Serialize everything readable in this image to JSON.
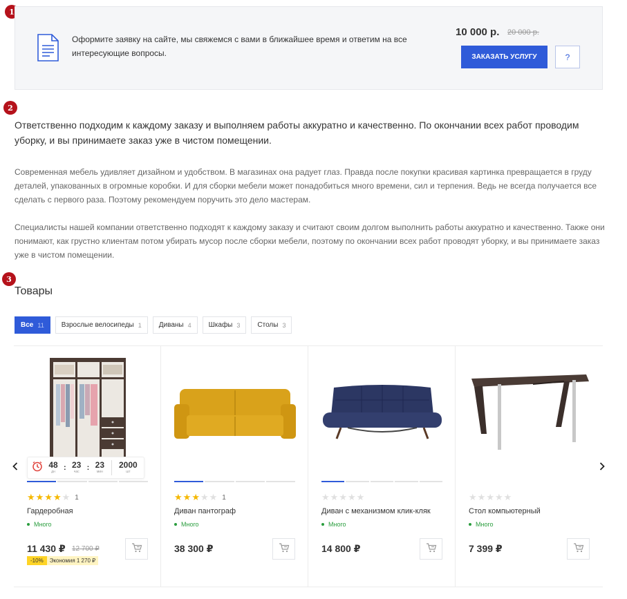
{
  "markers": [
    "1",
    "2",
    "3"
  ],
  "banner": {
    "text": "Оформите заявку на сайте, мы свяжемся с вами в ближайшее время и ответим на все интересующие вопросы.",
    "price": "10 000 р.",
    "old_price": "20 000 р.",
    "order_label": "ЗАКАЗАТЬ УСЛУГУ",
    "help_label": "?"
  },
  "content": {
    "lead": "Ответственно подходим к каждому заказу и выполняем работы аккуратно и качественно. По окончании всех работ проводим уборку, и вы принимаете заказ уже в чистом помещении.",
    "paragraph1": "Современная мебель удивляет дизайном и удобством. В магазинах она радует глаз. Правда после покупки красивая картинка превращается в груду деталей, упакованных в огромные коробки. И для сборки мебели может понадобиться много времени, сил и терпения. Ведь не всегда получается все сделать с первого раза. Поэтому рекомендуем поручить это дело мастерам.",
    "paragraph2": "Специалисты нашей компании ответственно подходят к каждому заказу и считают своим долгом выполнить работы аккуратно и качественно. Также они понимают, как грустно клиентам потом убирать мусор после сборки мебели, поэтому по окончании всех работ проводят уборку, и вы принимаете заказ уже в чистом помещении."
  },
  "products_section": {
    "title": "Товары",
    "filters": [
      {
        "label": "Все",
        "count": "11",
        "active": true
      },
      {
        "label": "Взрослые велосипеды",
        "count": "1",
        "active": false
      },
      {
        "label": "Диваны",
        "count": "4",
        "active": false
      },
      {
        "label": "Шкафы",
        "count": "3",
        "active": false
      },
      {
        "label": "Столы",
        "count": "3",
        "active": false
      }
    ],
    "products": [
      {
        "name": "Гардеробная",
        "stock": "Много",
        "price": "11 430 ₽",
        "old_price": "12 700 ₽",
        "rating": 4,
        "reviews": "1",
        "discount": "-10%",
        "economy": "Экономия 1 270 ₽",
        "image": "wardrobe",
        "dots": 4,
        "active_dot": 0,
        "timer": {
          "days": "48",
          "days_label": "дн",
          "hours": "23",
          "hours_label": "час",
          "minutes": "23",
          "minutes_label": "мин",
          "qty": "2000",
          "qty_label": "шт"
        }
      },
      {
        "name": "Диван пантограф",
        "stock": "Много",
        "price": "38 300 ₽",
        "rating": 3,
        "reviews": "1",
        "image": "yellow-sofa",
        "dots": 4,
        "active_dot": 0
      },
      {
        "name": "Диван с механизмом клик-кляк",
        "stock": "Много",
        "price": "14 800 ₽",
        "rating": 0,
        "image": "blue-sofa",
        "dots": 5,
        "active_dot": 0
      },
      {
        "name": "Стол компьютерный",
        "stock": "Много",
        "price": "7 399 ₽",
        "rating": 0,
        "image": "desk",
        "dots": 0,
        "active_dot": -1
      }
    ]
  },
  "colors": {
    "accent": "#2f5bd9",
    "stock": "#2a9d3e",
    "star": "#f5b800",
    "marker": "#b5121b"
  },
  "icons": [
    "document-icon",
    "cart-icon",
    "clock-icon",
    "chevron-left-icon",
    "chevron-right-icon"
  ]
}
